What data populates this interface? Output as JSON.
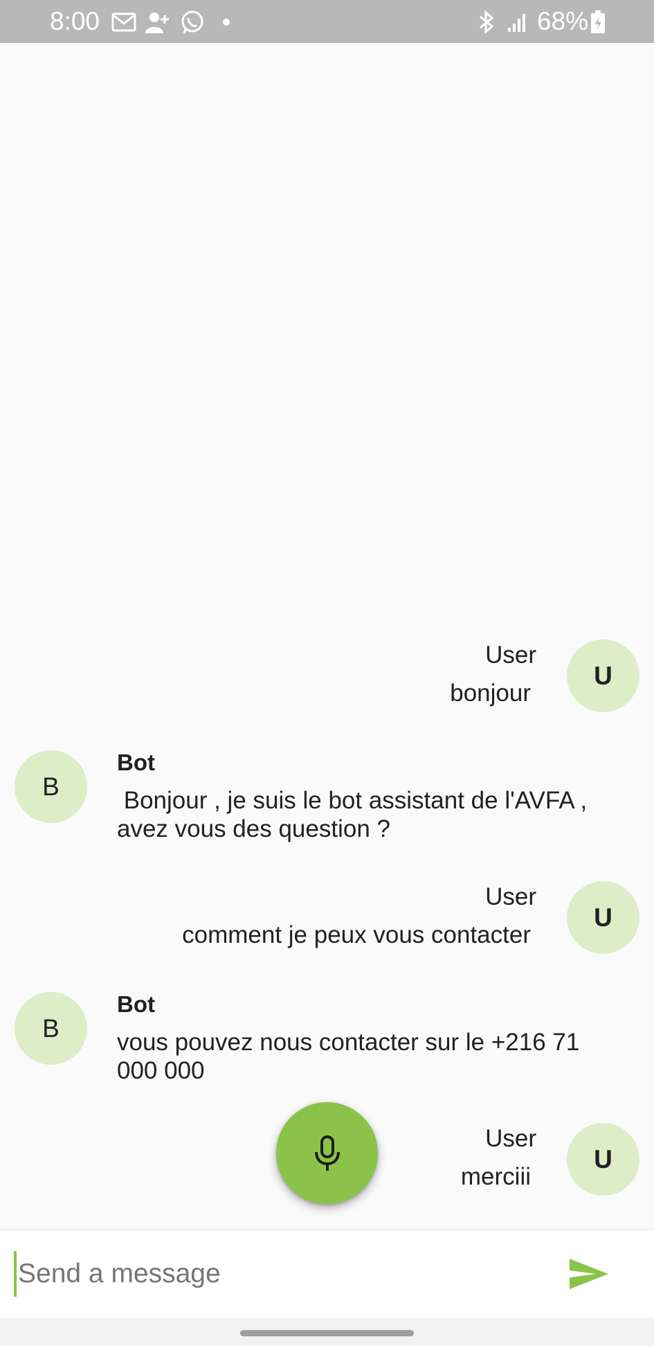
{
  "status_bar": {
    "time": "8:00",
    "battery": "68%",
    "icons": [
      "mail-icon",
      "add-contact-icon",
      "whatsapp-icon",
      "dot-icon",
      "bluetooth-icon",
      "signal-icon",
      "battery-charging-icon"
    ]
  },
  "messages": [
    {
      "sender": "User",
      "avatar": "U",
      "text": "bonjour"
    },
    {
      "sender": "Bot",
      "avatar": "B",
      "text": " Bonjour , je suis le bot assistant de l'AVFA ,\navez vous des question ?"
    },
    {
      "sender": "User",
      "avatar": "U",
      "text": "comment je peux vous contacter"
    },
    {
      "sender": "Bot",
      "avatar": "B",
      "text": "vous pouvez nous contacter sur le +216 71\n000 000"
    },
    {
      "sender": "User",
      "avatar": "U",
      "text": "merciii"
    }
  ],
  "composer": {
    "placeholder": "Send a message",
    "value": ""
  },
  "colors": {
    "accent": "#8bc34a",
    "avatar_bg": "#dcedc8",
    "background": "#fafafa",
    "status_bar": "#b8b8b8"
  }
}
